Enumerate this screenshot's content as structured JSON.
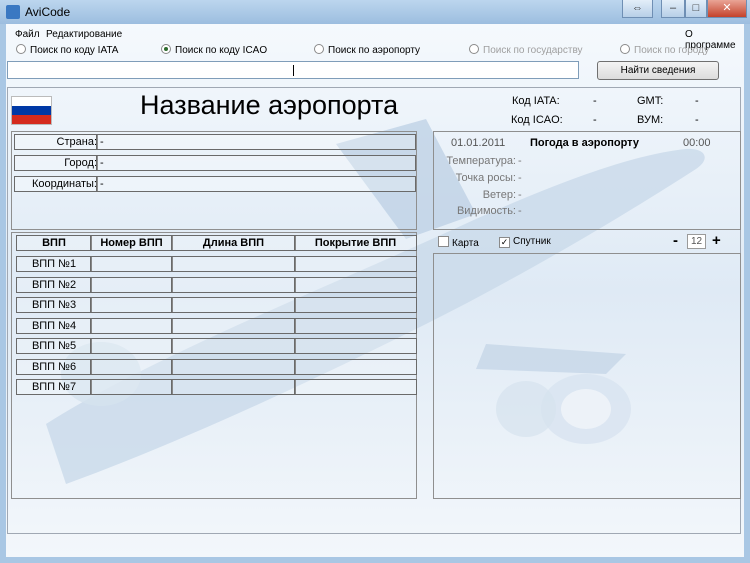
{
  "window": {
    "title": "AviCode",
    "buttons": {
      "restore": "⇔",
      "minimize": "–",
      "maximize": "□",
      "close": "✕"
    }
  },
  "menu": {
    "file": "Файл",
    "edit": "Редактирование",
    "about": "О программе"
  },
  "search_modes": [
    {
      "label": "Поиск по коду IATA",
      "selected": false,
      "enabled": true
    },
    {
      "label": "Поиск по коду ICAO",
      "selected": true,
      "enabled": true
    },
    {
      "label": "Поиск по аэропорту",
      "selected": false,
      "enabled": true
    },
    {
      "label": "Поиск по государству",
      "selected": false,
      "enabled": false
    },
    {
      "label": "Поиск по городу",
      "selected": false,
      "enabled": false
    }
  ],
  "search": {
    "value": "",
    "button": "Найти сведения"
  },
  "airport": {
    "name": "Название аэропорта",
    "flag_colors": [
      "#ffffff",
      "#0039a6",
      "#d52b1e"
    ],
    "iata_label": "Код IATA:",
    "iata_value": "-",
    "icao_label": "Код ICAO:",
    "icao_value": "-",
    "gmt_label": "GMT:",
    "gmt_value": "-",
    "vym_label": "ВУМ:",
    "vym_value": "-"
  },
  "info": [
    {
      "label": "Страна:",
      "value": "-"
    },
    {
      "label": "Город:",
      "value": "-"
    },
    {
      "label": "Координаты:",
      "value": "-"
    }
  ],
  "runways": {
    "headers": [
      "ВПП",
      "Номер ВПП",
      "Длина ВПП",
      "Покрытие  ВПП"
    ],
    "rows": [
      "ВПП №1",
      "ВПП №2",
      "ВПП №3",
      "ВПП №4",
      "ВПП №5",
      "ВПП №6",
      "ВПП №7"
    ]
  },
  "weather": {
    "date": "01.01.2011",
    "title": "Погода в аэропорту",
    "time": "00:00",
    "rows": [
      {
        "label": "Температура:",
        "value": "-"
      },
      {
        "label": "Точка росы:",
        "value": "-"
      },
      {
        "label": "Ветер:",
        "value": "-"
      },
      {
        "label": "Видимость:",
        "value": "-"
      }
    ]
  },
  "map": {
    "map_label": "Карта",
    "map_checked": false,
    "satellite_label": "Спутник",
    "satellite_checked": true,
    "zoom_minus": "-",
    "zoom": "12",
    "zoom_plus": "+"
  }
}
